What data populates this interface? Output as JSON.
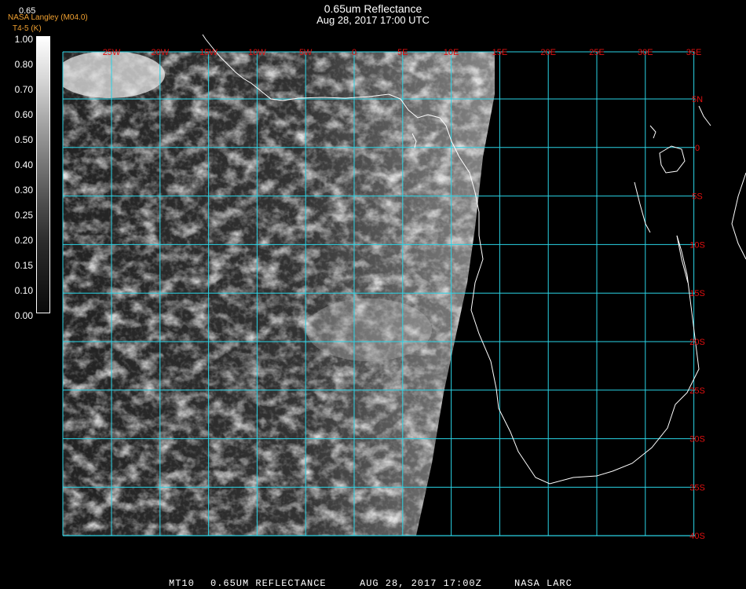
{
  "header": {
    "title": "0.65um Reflectance",
    "subtitle": "Aug 28, 2017 17:00 UTC",
    "credit": "NASA Langley (M04.0)",
    "channel_id": "T4-5 (K)",
    "colorbar_label": "0.65"
  },
  "colorbar": {
    "ticks": [
      "1.00",
      "0.80",
      "0.70",
      "0.60",
      "0.50",
      "0.40",
      "0.30",
      "0.25",
      "0.20",
      "0.15",
      "0.10",
      "0.00"
    ]
  },
  "map": {
    "lon_labels": [
      "25W",
      "20W",
      "15W",
      "10W",
      "5W",
      "0",
      "5E",
      "10E",
      "15E",
      "20E",
      "25E",
      "30E",
      "35E"
    ],
    "lat_labels": [
      "5N",
      "0",
      "5S",
      "10S",
      "15S",
      "20S",
      "25S",
      "30S",
      "35S",
      "40S"
    ],
    "grid_color": "#2ad4e6",
    "coast_color": "#ffffff",
    "label_color": "#e01010"
  },
  "footer": {
    "sat": "MT10",
    "product": "0.65UM REFLECTANCE",
    "datetime": "AUG 28, 2017 17:00Z",
    "org": "NASA LARC"
  }
}
